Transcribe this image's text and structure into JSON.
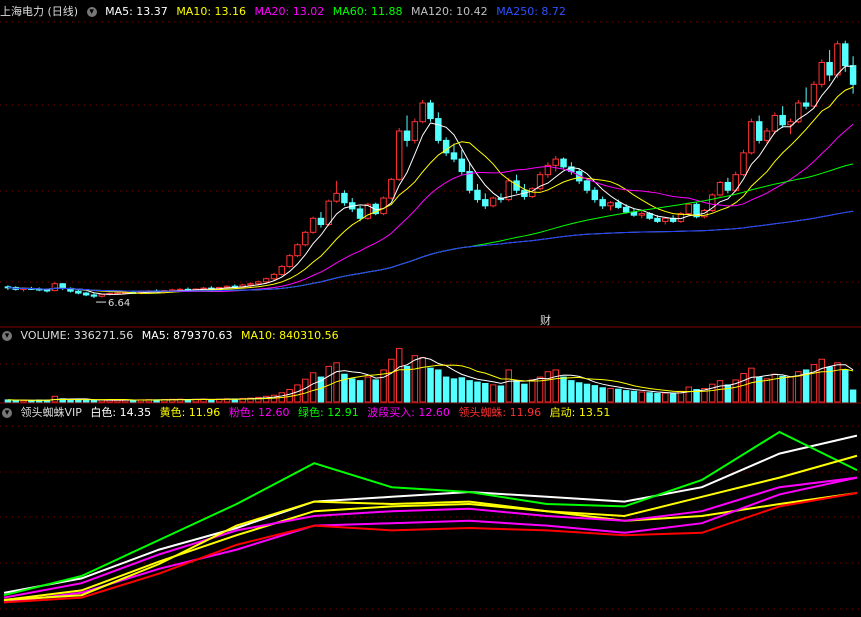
{
  "price_header": {
    "title": "上海电力 (日线)",
    "ma5": "MA5: 13.37",
    "ma10": "MA10: 13.16",
    "ma20": "MA20: 13.02",
    "ma60": "MA60: 11.88",
    "ma120": "MA120: 10.42",
    "ma250": "MA250: 8.72"
  },
  "volume_header": {
    "volume": "VOLUME: 336271.56",
    "ma5": "MA5: 879370.63",
    "ma10": "MA10: 840310.56"
  },
  "indicator_header": {
    "name": "领头蜘蛛VIP",
    "white": "白色: 14.35",
    "yellow": "黄色: 11.96",
    "pink": "粉色: 12.60",
    "green": "绿色: 12.91",
    "wave_buy": "波段买入: 12.60",
    "spider": "领头蜘蛛: 11.96",
    "start": "启动: 13.51"
  },
  "annotations": {
    "low_price": "6.64",
    "finance_marker": "财"
  },
  "colors": {
    "up": "#ff3232",
    "down": "#54ffff",
    "white": "#ffffff",
    "yellow": "#ffff00",
    "magenta": "#ff00ff",
    "green": "#00ff00",
    "gray": "#c0c0c0",
    "blue": "#2040ff",
    "grid": "#800000",
    "red": "#ff0000"
  },
  "chart_data": [
    {
      "type": "candlestick",
      "title": "上海电力 (日线)",
      "ylim": [
        6.0,
        15.5
      ],
      "candles": [
        [
          7.0,
          7.05,
          6.9,
          6.98
        ],
        [
          6.98,
          7.02,
          6.88,
          6.92
        ],
        [
          6.92,
          6.98,
          6.85,
          6.95
        ],
        [
          6.95,
          7.0,
          6.9,
          6.93
        ],
        [
          6.93,
          6.98,
          6.86,
          6.9
        ],
        [
          6.9,
          6.95,
          6.82,
          6.88
        ],
        [
          6.88,
          7.15,
          6.86,
          7.1
        ],
        [
          7.1,
          7.12,
          6.9,
          6.95
        ],
        [
          6.95,
          6.98,
          6.82,
          6.86
        ],
        [
          6.86,
          6.9,
          6.76,
          6.8
        ],
        [
          6.8,
          6.84,
          6.7,
          6.74
        ],
        [
          6.74,
          6.8,
          6.64,
          6.7
        ],
        [
          6.7,
          6.78,
          6.66,
          6.76
        ],
        [
          6.76,
          6.82,
          6.72,
          6.79
        ],
        [
          6.79,
          6.84,
          6.74,
          6.8
        ],
        [
          6.8,
          6.86,
          6.76,
          6.82
        ],
        [
          6.82,
          6.88,
          6.78,
          6.8
        ],
        [
          6.8,
          6.86,
          6.76,
          6.84
        ],
        [
          6.84,
          6.9,
          6.8,
          6.87
        ],
        [
          6.87,
          6.92,
          6.82,
          6.85
        ],
        [
          6.85,
          6.9,
          6.8,
          6.88
        ],
        [
          6.88,
          6.94,
          6.84,
          6.9
        ],
        [
          6.9,
          6.96,
          6.85,
          6.92
        ],
        [
          6.92,
          6.98,
          6.86,
          6.89
        ],
        [
          6.89,
          6.95,
          6.84,
          6.93
        ],
        [
          6.93,
          7.0,
          6.88,
          6.96
        ],
        [
          6.96,
          7.02,
          6.9,
          6.94
        ],
        [
          6.94,
          7.0,
          6.88,
          6.98
        ],
        [
          6.98,
          7.05,
          6.92,
          7.02
        ],
        [
          7.02,
          7.08,
          6.96,
          7.0
        ],
        [
          7.0,
          7.1,
          6.96,
          7.06
        ],
        [
          7.06,
          7.14,
          7.0,
          7.1
        ],
        [
          7.1,
          7.2,
          7.04,
          7.16
        ],
        [
          7.16,
          7.3,
          7.1,
          7.26
        ],
        [
          7.26,
          7.45,
          7.2,
          7.4
        ],
        [
          7.4,
          7.7,
          7.35,
          7.65
        ],
        [
          7.65,
          8.05,
          7.6,
          8.0
        ],
        [
          8.0,
          8.4,
          7.95,
          8.35
        ],
        [
          8.35,
          8.8,
          8.3,
          8.75
        ],
        [
          8.75,
          9.25,
          8.7,
          9.2
        ],
        [
          9.2,
          9.4,
          8.9,
          9.0
        ],
        [
          9.0,
          9.8,
          8.95,
          9.75
        ],
        [
          9.75,
          10.4,
          9.7,
          10.0
        ],
        [
          10.0,
          10.1,
          9.6,
          9.7
        ],
        [
          9.7,
          9.85,
          9.4,
          9.5
        ],
        [
          9.5,
          9.6,
          9.1,
          9.2
        ],
        [
          9.2,
          9.7,
          9.15,
          9.65
        ],
        [
          9.65,
          9.7,
          9.3,
          9.35
        ],
        [
          9.35,
          9.9,
          9.3,
          9.85
        ],
        [
          9.85,
          10.5,
          9.8,
          10.45
        ],
        [
          10.45,
          12.1,
          10.4,
          12.0
        ],
        [
          12.0,
          12.5,
          11.5,
          11.7
        ],
        [
          11.7,
          12.4,
          11.6,
          12.3
        ],
        [
          12.3,
          13.0,
          12.25,
          12.9
        ],
        [
          12.9,
          13.0,
          12.3,
          12.4
        ],
        [
          12.4,
          12.6,
          11.6,
          11.7
        ],
        [
          11.7,
          11.8,
          11.2,
          11.3
        ],
        [
          11.3,
          11.6,
          11.0,
          11.1
        ],
        [
          11.1,
          11.4,
          10.6,
          10.7
        ],
        [
          10.7,
          11.0,
          10.0,
          10.1
        ],
        [
          10.1,
          10.3,
          9.7,
          9.8
        ],
        [
          9.8,
          10.0,
          9.5,
          9.6
        ],
        [
          9.6,
          9.9,
          9.55,
          9.85
        ],
        [
          9.85,
          10.0,
          9.7,
          9.8
        ],
        [
          9.8,
          10.5,
          9.75,
          10.4
        ],
        [
          10.4,
          10.6,
          10.0,
          10.1
        ],
        [
          10.1,
          10.3,
          9.8,
          9.9
        ],
        [
          9.9,
          10.2,
          9.85,
          10.15
        ],
        [
          10.15,
          10.7,
          10.1,
          10.6
        ],
        [
          10.6,
          11.0,
          10.5,
          10.9
        ],
        [
          10.9,
          11.2,
          10.7,
          11.1
        ],
        [
          11.1,
          11.15,
          10.8,
          10.85
        ],
        [
          10.85,
          11.0,
          10.6,
          10.7
        ],
        [
          10.7,
          10.8,
          10.3,
          10.4
        ],
        [
          10.4,
          10.5,
          10.0,
          10.1
        ],
        [
          10.1,
          10.2,
          9.7,
          9.8
        ],
        [
          9.8,
          9.9,
          9.5,
          9.6
        ],
        [
          9.6,
          9.75,
          9.45,
          9.7
        ],
        [
          9.7,
          9.8,
          9.5,
          9.55
        ],
        [
          9.55,
          9.65,
          9.35,
          9.4
        ],
        [
          9.4,
          9.5,
          9.25,
          9.3
        ],
        [
          9.3,
          9.45,
          9.2,
          9.35
        ],
        [
          9.35,
          9.4,
          9.15,
          9.2
        ],
        [
          9.2,
          9.3,
          9.05,
          9.1
        ],
        [
          9.1,
          9.25,
          9.0,
          9.2
        ],
        [
          9.2,
          9.3,
          9.05,
          9.1
        ],
        [
          9.1,
          9.4,
          9.05,
          9.35
        ],
        [
          9.35,
          9.7,
          9.3,
          9.65
        ],
        [
          9.65,
          9.7,
          9.2,
          9.25
        ],
        [
          9.25,
          9.5,
          9.2,
          9.45
        ],
        [
          9.45,
          10.0,
          9.4,
          9.95
        ],
        [
          9.95,
          10.4,
          9.9,
          10.35
        ],
        [
          10.35,
          10.5,
          10.0,
          10.1
        ],
        [
          10.1,
          10.7,
          10.05,
          10.6
        ],
        [
          10.6,
          11.4,
          10.55,
          11.3
        ],
        [
          11.3,
          12.4,
          11.25,
          12.3
        ],
        [
          12.3,
          12.5,
          11.6,
          11.7
        ],
        [
          11.7,
          12.1,
          11.6,
          12.0
        ],
        [
          12.0,
          12.6,
          11.9,
          12.5
        ],
        [
          12.5,
          12.8,
          12.1,
          12.2
        ],
        [
          12.2,
          12.4,
          11.9,
          12.3
        ],
        [
          12.3,
          13.0,
          12.25,
          12.9
        ],
        [
          12.9,
          13.4,
          12.7,
          12.8
        ],
        [
          12.8,
          13.6,
          12.75,
          13.5
        ],
        [
          13.5,
          14.3,
          13.4,
          14.2
        ],
        [
          14.2,
          14.6,
          13.6,
          13.8
        ],
        [
          13.8,
          14.9,
          13.7,
          14.8
        ],
        [
          14.8,
          14.9,
          13.9,
          14.1
        ],
        [
          14.1,
          14.4,
          13.2,
          13.5
        ]
      ],
      "ma5_last": 13.37,
      "ma10_last": 13.16,
      "ma20_last": 13.02,
      "ma60_last": 11.88,
      "ma120_last": 10.42,
      "ma250_last": 8.72
    },
    {
      "type": "bar",
      "title": "VOLUME",
      "ylim": [
        0,
        1600000
      ],
      "values": [
        60000,
        50000,
        45000,
        40000,
        55000,
        50000,
        160000,
        90000,
        70000,
        60000,
        50000,
        45000,
        60000,
        55000,
        50000,
        60000,
        55000,
        60000,
        65000,
        60000,
        70000,
        75000,
        80000,
        70000,
        75000,
        80000,
        70000,
        80000,
        90000,
        85000,
        100000,
        110000,
        130000,
        160000,
        190000,
        260000,
        350000,
        480000,
        640000,
        820000,
        700000,
        1000000,
        1100000,
        780000,
        650000,
        600000,
        700000,
        620000,
        900000,
        1200000,
        1500000,
        1000000,
        1300000,
        1250000,
        950000,
        900000,
        700000,
        650000,
        680000,
        600000,
        560000,
        520000,
        480000,
        450000,
        900000,
        600000,
        500000,
        620000,
        700000,
        850000,
        900000,
        700000,
        600000,
        540000,
        500000,
        460000,
        400000,
        380000,
        360000,
        320000,
        300000,
        280000,
        260000,
        240000,
        250000,
        230000,
        300000,
        420000,
        350000,
        380000,
        500000,
        600000,
        480000,
        620000,
        800000,
        950000,
        700000,
        650000,
        780000,
        720000,
        700000,
        850000,
        900000,
        1050000,
        1200000,
        980000,
        1100000,
        900000,
        336271.56
      ],
      "ma5_last": 879370.63,
      "ma10_last": 840310.56
    },
    {
      "type": "line",
      "title": "领头蜘蛛VIP",
      "series": [
        {
          "name": "白色",
          "values": [
            7.8,
            8.4,
            9.6,
            10.5,
            11.6,
            11.8,
            12.0,
            11.8,
            11.6,
            12.2,
            13.6,
            14.35
          ]
        },
        {
          "name": "黄色",
          "values": [
            7.5,
            7.9,
            9.1,
            10.2,
            11.2,
            11.4,
            11.5,
            11.2,
            10.8,
            11.0,
            11.5,
            11.96
          ]
        },
        {
          "name": "粉色",
          "values": [
            7.6,
            8.2,
            9.4,
            10.4,
            11.0,
            11.2,
            11.3,
            11.0,
            10.8,
            11.2,
            12.2,
            12.6
          ]
        },
        {
          "name": "绿色",
          "values": [
            7.7,
            8.5,
            10.0,
            11.5,
            13.2,
            12.2,
            12.0,
            11.5,
            11.4,
            12.5,
            14.5,
            12.91
          ]
        },
        {
          "name": "波段买入",
          "values": [
            7.4,
            7.8,
            8.8,
            9.6,
            10.6,
            10.7,
            10.8,
            10.6,
            10.3,
            10.7,
            11.9,
            12.6
          ]
        },
        {
          "name": "领头蜘蛛",
          "values": [
            7.4,
            7.6,
            8.6,
            9.8,
            10.6,
            10.4,
            10.5,
            10.4,
            10.2,
            10.3,
            11.4,
            11.96
          ]
        },
        {
          "name": "启动",
          "values": [
            7.5,
            7.7,
            9.0,
            10.6,
            11.6,
            11.5,
            11.6,
            11.2,
            11.0,
            11.8,
            12.6,
            13.51
          ]
        }
      ]
    }
  ]
}
